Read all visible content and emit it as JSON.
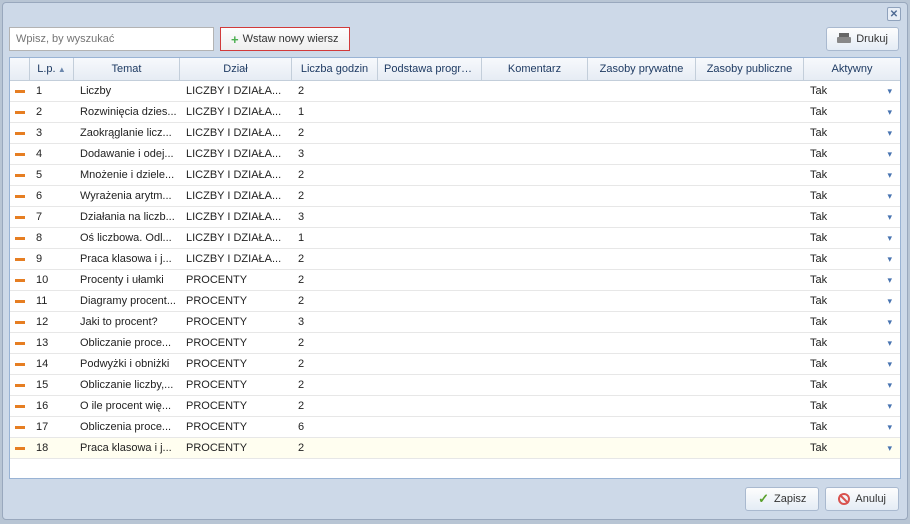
{
  "search": {
    "placeholder": "Wpisz, by wyszukać"
  },
  "buttons": {
    "insert": "Wstaw nowy wiersz",
    "print": "Drukuj",
    "save": "Zapisz",
    "cancel": "Anuluj"
  },
  "headers": {
    "lp": "L.p.",
    "temat": "Temat",
    "dzial": "Dział",
    "godz": "Liczba godzin",
    "podst": "Podstawa progra...",
    "kom": "Komentarz",
    "pryw": "Zasoby prywatne",
    "publ": "Zasoby publiczne",
    "aktyw": "Aktywny"
  },
  "rows": [
    {
      "lp": "1",
      "temat": "Liczby",
      "dzial": "LICZBY I DZIAŁA...",
      "godz": "2",
      "aktyw": "Tak"
    },
    {
      "lp": "2",
      "temat": "Rozwinięcia dzies...",
      "dzial": "LICZBY I DZIAŁA...",
      "godz": "1",
      "aktyw": "Tak"
    },
    {
      "lp": "3",
      "temat": "Zaokrąglanie licz...",
      "dzial": "LICZBY I DZIAŁA...",
      "godz": "2",
      "aktyw": "Tak"
    },
    {
      "lp": "4",
      "temat": "Dodawanie i odej...",
      "dzial": "LICZBY I DZIAŁA...",
      "godz": "3",
      "aktyw": "Tak"
    },
    {
      "lp": "5",
      "temat": "Mnożenie i dziele...",
      "dzial": "LICZBY I DZIAŁA...",
      "godz": "2",
      "aktyw": "Tak"
    },
    {
      "lp": "6",
      "temat": "Wyrażenia arytm...",
      "dzial": "LICZBY I DZIAŁA...",
      "godz": "2",
      "aktyw": "Tak"
    },
    {
      "lp": "7",
      "temat": "Działania na liczb...",
      "dzial": "LICZBY I DZIAŁA...",
      "godz": "3",
      "aktyw": "Tak"
    },
    {
      "lp": "8",
      "temat": "Oś liczbowa. Odl...",
      "dzial": "LICZBY I DZIAŁA...",
      "godz": "1",
      "aktyw": "Tak"
    },
    {
      "lp": "9",
      "temat": "Praca klasowa i j...",
      "dzial": "LICZBY I DZIAŁA...",
      "godz": "2",
      "aktyw": "Tak"
    },
    {
      "lp": "10",
      "temat": "Procenty i ułamki",
      "dzial": "PROCENTY",
      "godz": "2",
      "aktyw": "Tak"
    },
    {
      "lp": "11",
      "temat": "Diagramy procent...",
      "dzial": "PROCENTY",
      "godz": "2",
      "aktyw": "Tak"
    },
    {
      "lp": "12",
      "temat": "Jaki to procent?",
      "dzial": "PROCENTY",
      "godz": "3",
      "aktyw": "Tak"
    },
    {
      "lp": "13",
      "temat": "Obliczanie proce...",
      "dzial": "PROCENTY",
      "godz": "2",
      "aktyw": "Tak"
    },
    {
      "lp": "14",
      "temat": "Podwyżki i obniżki",
      "dzial": "PROCENTY",
      "godz": "2",
      "aktyw": "Tak"
    },
    {
      "lp": "15",
      "temat": "Obliczanie liczby,...",
      "dzial": "PROCENTY",
      "godz": "2",
      "aktyw": "Tak"
    },
    {
      "lp": "16",
      "temat": "O ile procent wię...",
      "dzial": "PROCENTY",
      "godz": "2",
      "aktyw": "Tak"
    },
    {
      "lp": "17",
      "temat": "Obliczenia proce...",
      "dzial": "PROCENTY",
      "godz": "6",
      "aktyw": "Tak"
    },
    {
      "lp": "18",
      "temat": "Praca klasowa i j...",
      "dzial": "PROCENTY",
      "godz": "2",
      "aktyw": "Tak"
    }
  ]
}
